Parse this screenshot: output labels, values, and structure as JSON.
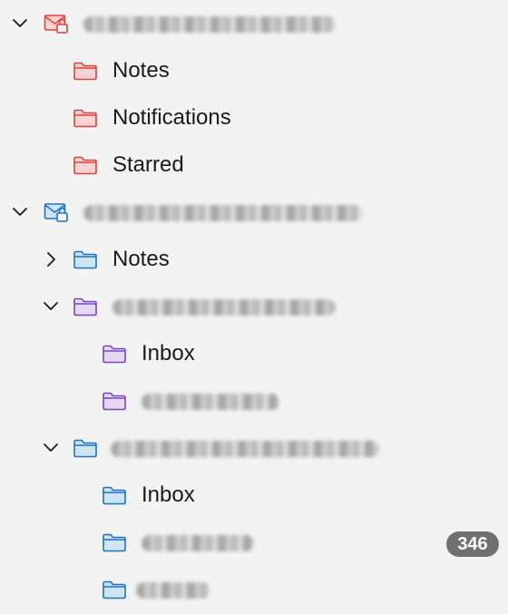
{
  "colors": {
    "red_stroke": "#e0413b",
    "red_fill": "#fbd3d3",
    "blue_stroke": "#1f73c4",
    "blue_fill": "#cfe4f5",
    "purple_stroke": "#7b44c4",
    "purple_fill": "#e5d8f5",
    "badge_bg": "#707070"
  },
  "tree": {
    "account1": {
      "name": "",
      "name_redacted": true,
      "icon": "account-mail-lock-icon",
      "expanded": true,
      "folders": [
        {
          "label": "Notes",
          "icon": "folder-icon"
        },
        {
          "label": "Notifications",
          "icon": "folder-icon"
        },
        {
          "label": "Starred",
          "icon": "folder-icon"
        }
      ]
    },
    "account2": {
      "name": "",
      "name_redacted": true,
      "icon": "account-mail-lock-icon",
      "expanded": true,
      "notes_folder": {
        "label": "Notes",
        "expanded": false
      },
      "subaccount_purple": {
        "name": "",
        "name_redacted": true,
        "expanded": true,
        "folders": [
          {
            "label": "Inbox"
          },
          {
            "label": "",
            "redacted": true
          }
        ]
      },
      "subaccount_blue": {
        "name": "",
        "name_redacted": true,
        "expanded": true,
        "folders": [
          {
            "label": "Inbox"
          },
          {
            "label": "",
            "redacted": true,
            "unread_count": "346"
          },
          {
            "label": "",
            "redacted": true
          }
        ]
      }
    }
  }
}
